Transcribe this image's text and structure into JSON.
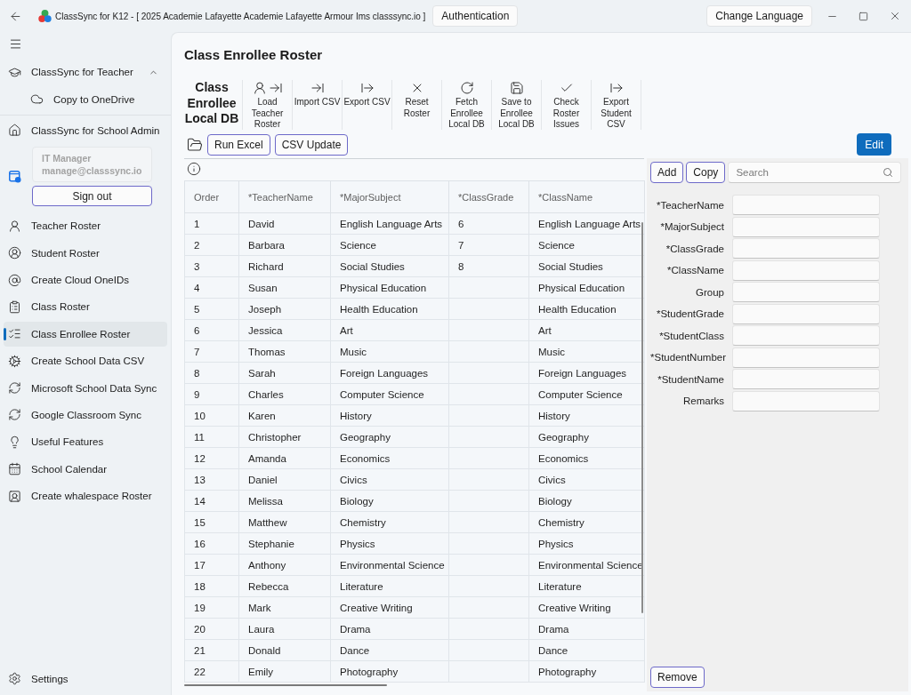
{
  "title_bar": {
    "title": "ClassSync for K12 - [ 2025 Academie Lafayette Academie Lafayette Armour Ims classsync.io ]",
    "auth_button": "Authentication",
    "language_button": "Change Language"
  },
  "sidebar": {
    "groups": [
      {
        "label": "ClassSync for Teacher",
        "selected": false,
        "expanded": true,
        "children": [
          {
            "label": "Copy to OneDrive",
            "selected": false
          }
        ]
      },
      {
        "label": "ClassSync for School Admin",
        "selected": false
      }
    ],
    "account": {
      "name": "IT Manager",
      "email": "manage@classsync.io",
      "sign_out": "Sign out"
    },
    "items": [
      {
        "label": "Teacher Roster",
        "selected": false
      },
      {
        "label": "Student Roster",
        "selected": false
      },
      {
        "label": "Create Cloud OneIDs",
        "selected": false
      },
      {
        "label": "Class Roster",
        "selected": false
      },
      {
        "label": "Class Enrollee Roster",
        "selected": true
      },
      {
        "label": "Create School Data CSV",
        "selected": false
      },
      {
        "label": "Microsoft School Data Sync",
        "selected": false
      },
      {
        "label": "Google Classroom Sync",
        "selected": false
      },
      {
        "label": "Useful Features",
        "selected": false
      },
      {
        "label": "School Calendar",
        "selected": false
      },
      {
        "label": "Create whalespace Roster",
        "selected": false
      }
    ],
    "settings": {
      "label": "Settings",
      "selected": false
    }
  },
  "page": {
    "title": "Class Enrollee Roster",
    "toolbar": {
      "title": "Class Enrollee Local DB",
      "buttons": [
        {
          "label": "Load Teacher Roster"
        },
        {
          "label": "Import CSV"
        },
        {
          "label": "Export CSV"
        },
        {
          "label": "Reset Roster"
        },
        {
          "label": "Fetch Enrollee Local DB"
        },
        {
          "label": "Save to Enrollee Local DB"
        },
        {
          "label": "Check Roster Issues"
        },
        {
          "label": "Export Student CSV"
        }
      ]
    },
    "actions": [
      "Run Excel",
      "CSV Update"
    ],
    "edit_button": "Edit"
  },
  "table": {
    "columns": [
      "Order",
      "*TeacherName",
      "*MajorSubject",
      "*ClassGrade",
      "*ClassName"
    ],
    "rows": [
      {
        "order": "1",
        "teacher_name": "David",
        "major_subject": "English Language Arts",
        "class_grade": "6",
        "class_name": "English Language Arts"
      },
      {
        "order": "2",
        "teacher_name": "Barbara",
        "major_subject": "Science",
        "class_grade": "7",
        "class_name": "Science"
      },
      {
        "order": "3",
        "teacher_name": "Richard",
        "major_subject": "Social Studies",
        "class_grade": "8",
        "class_name": "Social Studies"
      },
      {
        "order": "4",
        "teacher_name": "Susan",
        "major_subject": "Physical Education",
        "class_name": "Physical Education"
      },
      {
        "order": "5",
        "teacher_name": "Joseph",
        "major_subject": "Health Education",
        "class_name": "Health Education"
      },
      {
        "order": "6",
        "teacher_name": "Jessica",
        "major_subject": "Art",
        "class_name": "Art"
      },
      {
        "order": "7",
        "teacher_name": "Thomas",
        "major_subject": "Music",
        "class_name": "Music"
      },
      {
        "order": "8",
        "teacher_name": "Sarah",
        "major_subject": "Foreign Languages",
        "class_name": "Foreign Languages"
      },
      {
        "order": "9",
        "teacher_name": "Charles",
        "major_subject": "Computer Science",
        "class_name": "Computer Science"
      },
      {
        "order": "10",
        "teacher_name": "Karen",
        "major_subject": "History",
        "class_name": "History"
      },
      {
        "order": "11",
        "teacher_name": "Christopher",
        "major_subject": "Geography",
        "class_name": "Geography"
      },
      {
        "order": "12",
        "teacher_name": "Amanda",
        "major_subject": "Economics",
        "class_name": "Economics"
      },
      {
        "order": "13",
        "teacher_name": "Daniel",
        "major_subject": "Civics",
        "class_name": "Civics"
      },
      {
        "order": "14",
        "teacher_name": "Melissa",
        "major_subject": "Biology",
        "class_name": "Biology"
      },
      {
        "order": "15",
        "teacher_name": "Matthew",
        "major_subject": "Chemistry",
        "class_name": "Chemistry"
      },
      {
        "order": "16",
        "teacher_name": "Stephanie",
        "major_subject": "Physics",
        "class_name": "Physics"
      },
      {
        "order": "17",
        "teacher_name": "Anthony",
        "major_subject": "Environmental Science",
        "class_name": "Environmental Science"
      },
      {
        "order": "18",
        "teacher_name": "Rebecca",
        "major_subject": "Literature",
        "class_name": "Literature"
      },
      {
        "order": "19",
        "teacher_name": "Mark",
        "major_subject": "Creative Writing",
        "class_name": "Creative Writing"
      },
      {
        "order": "20",
        "teacher_name": "Laura",
        "major_subject": "Drama",
        "class_name": "Drama"
      },
      {
        "order": "21",
        "teacher_name": "Donald",
        "major_subject": "Dance",
        "class_name": "Dance"
      },
      {
        "order": "22",
        "teacher_name": "Emily",
        "major_subject": "Photography",
        "class_name": "Photography"
      }
    ]
  },
  "form": {
    "buttons": [
      "Add",
      "Copy"
    ],
    "search": {
      "placeholder": "Search"
    },
    "fields": [
      {
        "label": "*TeacherName"
      },
      {
        "label": "*MajorSubject"
      },
      {
        "label": "*ClassGrade"
      },
      {
        "label": "*ClassName"
      },
      {
        "label": "Group"
      },
      {
        "label": "*StudentGrade"
      },
      {
        "label": "*StudentClass"
      },
      {
        "label": "*StudentNumber"
      },
      {
        "label": "*StudentName"
      },
      {
        "label": "Remarks"
      }
    ],
    "remove_button": "Remove"
  }
}
